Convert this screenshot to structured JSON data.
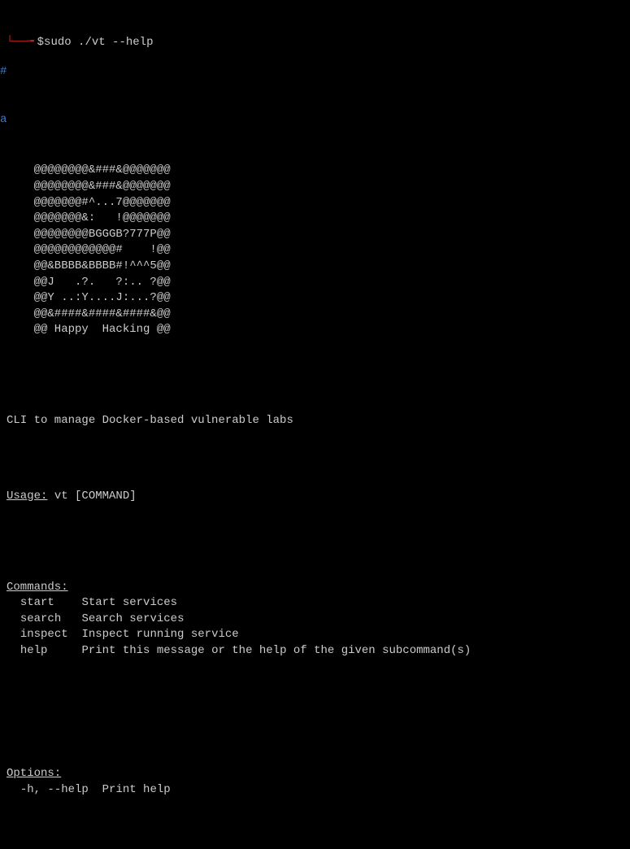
{
  "prompt": {
    "arrow": "└──╼",
    "dollar": "$",
    "command": "sudo ./vt --help"
  },
  "left_margin": {
    "char1": "#",
    "char2": "a"
  },
  "ascii_art": [
    "    @@@@@@@@&###&@@@@@@@",
    "    @@@@@@@@&###&@@@@@@@",
    "    @@@@@@@#^...7@@@@@@@",
    "    @@@@@@@&:   !@@@@@@@",
    "    @@@@@@@@BGGGB?777P@@",
    "    @@@@@@@@@@@@#    !@@",
    "    @@&BBBB&BBBB#!^^^5@@",
    "    @@J   .?.   ?:.. ?@@",
    "    @@Y ..:Y....J:...?@@",
    "    @@&####&####&####&@@",
    "    @@ Happy  Hacking @@"
  ],
  "description": "CLI to manage Docker-based vulnerable labs",
  "usage": {
    "label": "Usage:",
    "text": " vt [COMMAND]"
  },
  "commands_header": "Commands:",
  "commands": [
    {
      "name": "start",
      "desc": "Start services"
    },
    {
      "name": "search",
      "desc": "Search services"
    },
    {
      "name": "inspect",
      "desc": "Inspect running service"
    },
    {
      "name": "help",
      "desc": "Print this message or the help of the given subcommand(s)"
    }
  ],
  "options_header": "Options:",
  "options": [
    {
      "name": "-h, --help",
      "desc": "Print help"
    }
  ]
}
